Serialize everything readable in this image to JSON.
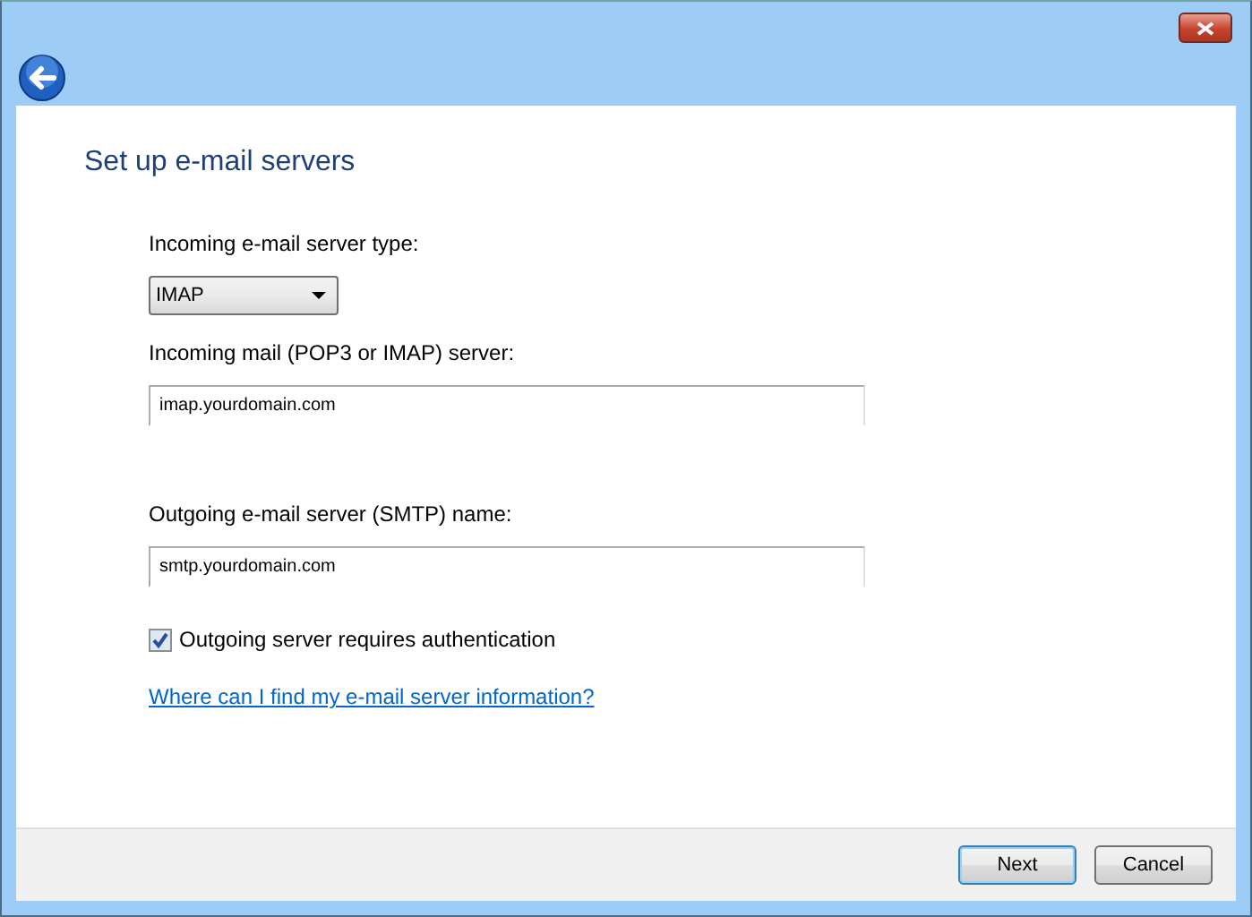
{
  "window": {
    "heading": "Set up e-mail servers"
  },
  "server_type": {
    "label": "Incoming e-mail server type:",
    "value": "IMAP"
  },
  "incoming_server": {
    "label": "Incoming mail (POP3 or IMAP) server:",
    "value": "imap.yourdomain.com"
  },
  "outgoing_server": {
    "label": "Outgoing e-mail server (SMTP) name:",
    "value": "smtp.yourdomain.com"
  },
  "auth": {
    "label": "Outgoing server requires authentication",
    "checked": true
  },
  "help_link": "Where can I find my e-mail server information?",
  "buttons": [
    {
      "label": "Next",
      "default": true
    },
    {
      "label": "Cancel",
      "default": false
    }
  ]
}
